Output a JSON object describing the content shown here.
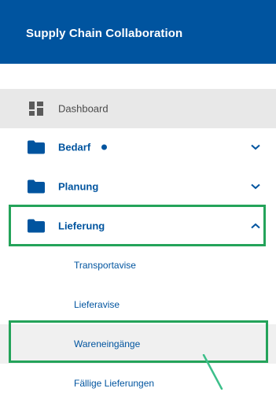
{
  "header": {
    "title": "Supply Chain Collaboration"
  },
  "nav": {
    "dashboard": {
      "label": "Dashboard"
    },
    "bedarf": {
      "label": "Bedarf"
    },
    "planung": {
      "label": "Planung"
    },
    "lieferung": {
      "label": "Lieferung",
      "subitems": [
        {
          "label": "Transportavise"
        },
        {
          "label": "Lieferavise"
        },
        {
          "label": "Wareneingänge"
        },
        {
          "label": "Fällige Lieferungen"
        }
      ]
    }
  },
  "icons": {
    "dashboard": "dashboard-grid-icon",
    "folder": "folder-icon",
    "chevron_down": "chevron-down-icon",
    "chevron_up": "chevron-up-icon",
    "notification_dot": "notification-dot-icon"
  },
  "colors": {
    "brand_blue": "#00549f",
    "active_bg": "#e8e8e8",
    "highlight_green": "#24a35a",
    "annotation_line": "#3dbf8a"
  }
}
